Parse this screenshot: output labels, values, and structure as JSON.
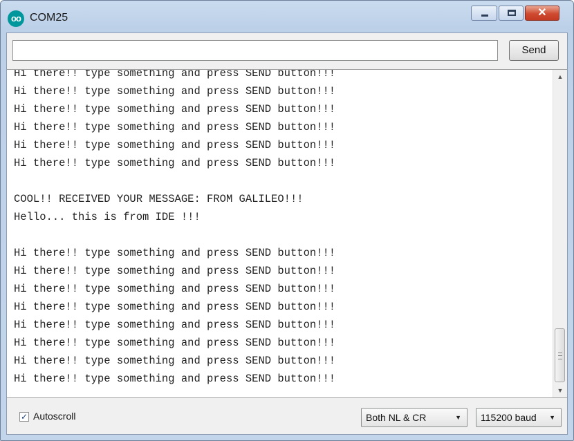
{
  "window": {
    "title": "COM25",
    "icon": "arduino-icon",
    "icon_glyph": "oo",
    "controls": {
      "minimize": "minimize-icon",
      "maximize": "maximize-icon",
      "close_glyph": "✕"
    }
  },
  "input": {
    "value": "",
    "placeholder": ""
  },
  "send_label": "Send",
  "output_lines": [
    "Hi there!! type something and press SEND button!!!",
    "Hi there!! type something and press SEND button!!!",
    "Hi there!! type something and press SEND button!!!",
    "Hi there!! type something and press SEND button!!!",
    "Hi there!! type something and press SEND button!!!",
    "Hi there!! type something and press SEND button!!!",
    "",
    "COOL!! RECEIVED YOUR MESSAGE: FROM GALILEO!!!",
    "Hello... this is from IDE !!!",
    "",
    "Hi there!! type something and press SEND button!!!",
    "Hi there!! type something and press SEND button!!!",
    "Hi there!! type something and press SEND button!!!",
    "Hi there!! type something and press SEND button!!!",
    "Hi there!! type something and press SEND button!!!",
    "Hi there!! type something and press SEND button!!!",
    "Hi there!! type something and press SEND button!!!",
    "Hi there!! type something and press SEND button!!!"
  ],
  "footer": {
    "autoscroll_label": "Autoscroll",
    "autoscroll_checked": true,
    "check_glyph": "✓",
    "line_ending": "Both NL & CR",
    "baud_rate": "115200 baud",
    "dropdown_glyph": "▼"
  },
  "scrollbar": {
    "up_glyph": "▲",
    "down_glyph": "▼"
  },
  "colors": {
    "title_bar": "#c9dbee",
    "close_button": "#cf4a30",
    "app_icon": "#00979c"
  }
}
